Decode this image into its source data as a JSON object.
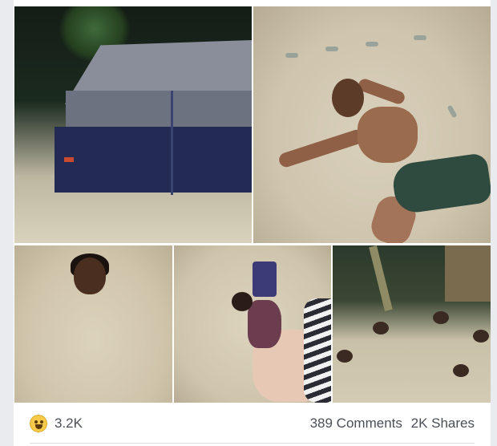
{
  "post": {
    "photos": [
      {
        "name": "photo-tent"
      },
      {
        "name": "photo-man-on-sand"
      },
      {
        "name": "photo-man-buried"
      },
      {
        "name": "photo-woman-sleeping"
      },
      {
        "name": "photo-people-buried-night"
      }
    ],
    "reactions": {
      "icon": "haha-emoji-icon",
      "count": "3.2K"
    },
    "comments_label": "389 Comments",
    "shares_label": "2K Shares",
    "colors": {
      "card_bg": "#ffffff",
      "page_bg": "#e9ebee",
      "text_secondary": "#4b4f56",
      "emoji_yellow": "#f7c94a"
    }
  }
}
